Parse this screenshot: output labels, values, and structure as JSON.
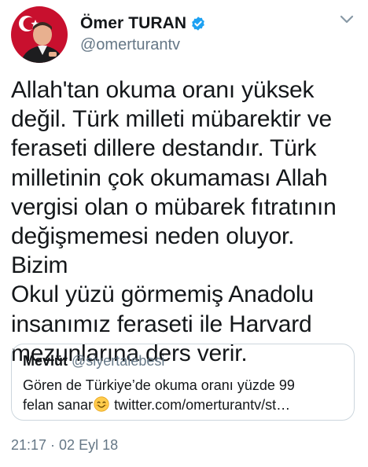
{
  "tweet": {
    "author": {
      "display_name": "Ömer TURAN",
      "handle": "@omerturantv",
      "verified": true,
      "avatar_icon": "profile-photo"
    },
    "text": "Allah'tan okuma oranı yüksek\ndeğil. Türk milleti mübarektir ve\nferaseti dillere destandır. Türk\nmilletinin çok okumaması Allah\nvergisi olan o mübarek fıtratının\ndeğişmemesi neden oluyor. Bizim\nOkul yüzü görmemiş Anadolu\ninsanımız feraseti ile Harvard\nmezunlarına ders verir.",
    "quoted": {
      "name": "Mevlüt",
      "handle": "@siyertalebesi",
      "line1": "Gören de Türkiye’de okuma oranı yüzde 99",
      "line2_prefix": "felan sanar",
      "emoji_icon": "grinning-face-emoji",
      "line2_suffix": " twitter.com/omerturantv/st…"
    },
    "timestamp": "21:17 · 02 Eyl 18",
    "menu_icon": "chevron-down-icon"
  },
  "colors": {
    "text_primary": "#14171a",
    "text_secondary": "#657786",
    "verified_blue": "#1da1f2",
    "border": "#ccd6dd"
  }
}
